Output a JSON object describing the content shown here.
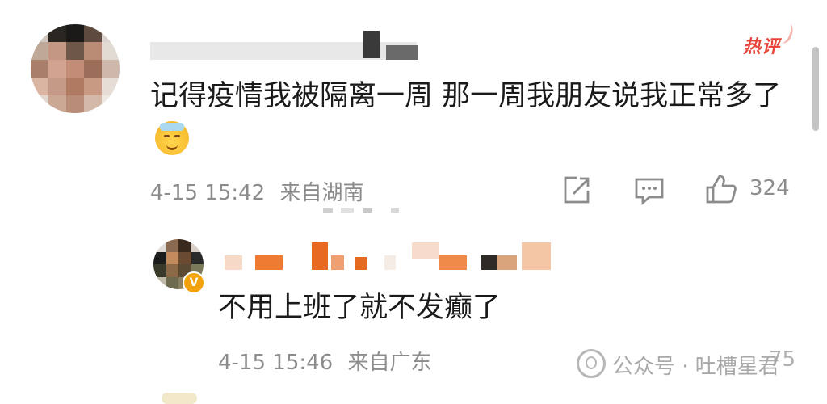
{
  "comment": {
    "badge": "热评",
    "text": "记得疫情我被隔离一周 那一周我朋友说我正常多了",
    "time": "4-15 15:42",
    "location": "来自湖南",
    "like_count": "324",
    "emoji": "sick-face-emoji"
  },
  "reply": {
    "text": "不用上班了就不发癫了",
    "time": "4-15 15:46",
    "location": "来自广东",
    "like_count": "75"
  },
  "watermark": {
    "text": "公众号 · 吐槽星君"
  },
  "colors": {
    "hot": "#e8463a",
    "meta": "#8c8c8c",
    "text": "#1a1a1a",
    "verified": "#f2a20c"
  },
  "icons": {
    "share": "share-icon",
    "comment": "comment-icon",
    "like": "thumbs-up-icon"
  }
}
